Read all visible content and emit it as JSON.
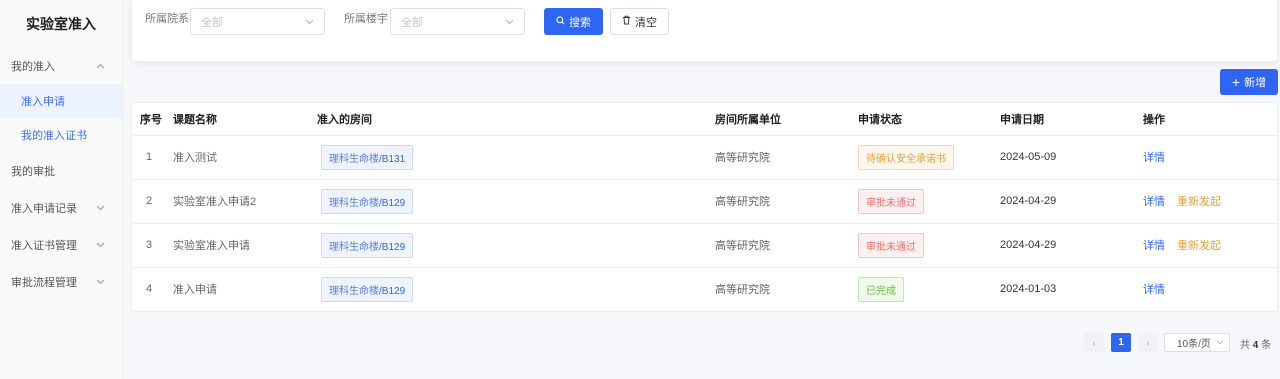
{
  "sidebar": {
    "title": "实验室准入",
    "items": [
      {
        "label": "我的准入"
      },
      {
        "label": "准入申请"
      },
      {
        "label": "我的准入证书"
      },
      {
        "label": "我的审批"
      },
      {
        "label": "准入申请记录"
      },
      {
        "label": "准入证书管理"
      },
      {
        "label": "审批流程管理"
      }
    ]
  },
  "filters": {
    "dept_label": "所属院系",
    "dept_value": "全部",
    "building_label": "所属楼宇",
    "building_value": "全部",
    "search_label": "搜索",
    "clear_label": "清空"
  },
  "toolbar": {
    "add_label": "新增"
  },
  "table": {
    "headers": [
      "序号",
      "课题名称",
      "准入的房间",
      "房间所属单位",
      "申请状态",
      "申请日期",
      "操作"
    ],
    "rows": [
      {
        "idx": "1",
        "name": "准入测试",
        "room_building": "理科生命楼",
        "room_code": "/B131",
        "unit": "高等研究院",
        "status": "待确认安全承诺书",
        "date": "2024-05-09",
        "detail": "详情",
        "restart": ""
      },
      {
        "idx": "2",
        "name": "实验室准入申请2",
        "room_building": "理科生命楼",
        "room_code": "/B129",
        "unit": "高等研究院",
        "status": "审批未通过",
        "date": "2024-04-29",
        "detail": "详情",
        "restart": "重新发起"
      },
      {
        "idx": "3",
        "name": "实验室准入申请",
        "room_building": "理科生命楼",
        "room_code": "/B129",
        "unit": "高等研究院",
        "status": "审批未通过",
        "date": "2024-04-29",
        "detail": "详情",
        "restart": "重新发起"
      },
      {
        "idx": "4",
        "name": "准入申请",
        "room_building": "理科生命楼",
        "room_code": "/B129",
        "unit": "高等研究院",
        "status": "已完成",
        "date": "2024-01-03",
        "detail": "详情",
        "restart": ""
      }
    ]
  },
  "pagination": {
    "prev": "‹",
    "current": "1",
    "next": "›",
    "page_size": "10条/页",
    "total_prefix": "共",
    "total": "4",
    "total_suffix": "条"
  },
  "colors": {
    "primary": "#2e65f3",
    "warning": "#e6a23c",
    "danger": "#f56c6c",
    "success": "#67c23a"
  }
}
